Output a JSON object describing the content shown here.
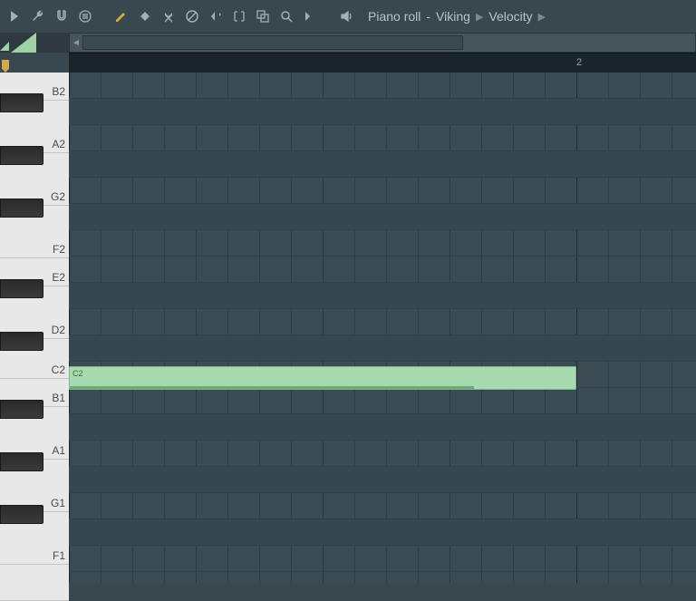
{
  "breadcrumb": {
    "title": "Piano roll",
    "channel": "Viking",
    "property": "Velocity"
  },
  "ruler": {
    "bar2": "2"
  },
  "keys": {
    "B2": "B2",
    "A2": "A2",
    "G2": "G2",
    "F2": "F2",
    "E2": "E2",
    "D2": "D2",
    "C2": "C2",
    "B1": "B1",
    "A1": "A1",
    "G1": "G1",
    "F1": "F1"
  },
  "note": {
    "label": "C2",
    "pitch": "C2",
    "start_bar": 1,
    "length_bars": 1,
    "velocity_ratio": 0.8
  },
  "colors": {
    "note": "#a8dab0",
    "accent": "#d4a94a",
    "grid_bg": "#3a4b54"
  }
}
